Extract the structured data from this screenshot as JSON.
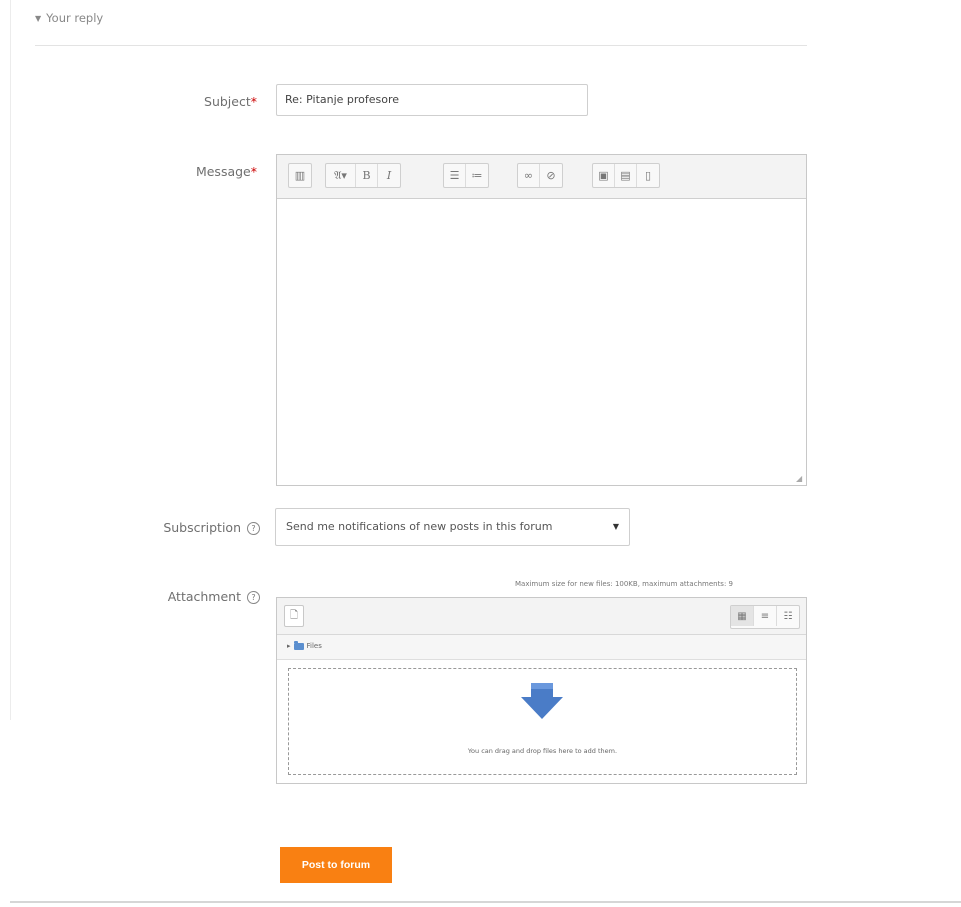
{
  "section": {
    "toggle_icon": "triangle-down-icon",
    "title": "Your reply"
  },
  "subject": {
    "label": "Subject",
    "required_mark": "*",
    "value": "Re: Pitanje profesore"
  },
  "message": {
    "label": "Message",
    "required_mark": "*",
    "toolbar": {
      "toggle": "▥",
      "para_style": "𝔄▾",
      "bold": "B",
      "italic": "I",
      "ul": "☰",
      "ol": "≔",
      "link": "∞",
      "unlink": "⊘",
      "image": "▣",
      "media": "▤",
      "manage_files": "▯"
    },
    "content": ""
  },
  "subscription": {
    "label": "Subscription",
    "help_icon": "?",
    "selected": "Send me notifications of new posts in this forum",
    "caret": "▼"
  },
  "attachment": {
    "label": "Attachment",
    "help_icon": "?",
    "max_note": "Maximum size for new files: 100KB, maximum attachments: 9",
    "add_icon": "🗋",
    "views": [
      "▦",
      "≡",
      "☷"
    ],
    "path_toggle": "▸",
    "path_label": "Files",
    "drop_text": "You can drag and drop files here to add them."
  },
  "submit": {
    "label": "Post to forum"
  },
  "colors": {
    "accent": "#f98012",
    "required": "#cc0000",
    "drop_arrow": "#4a7cc7"
  }
}
